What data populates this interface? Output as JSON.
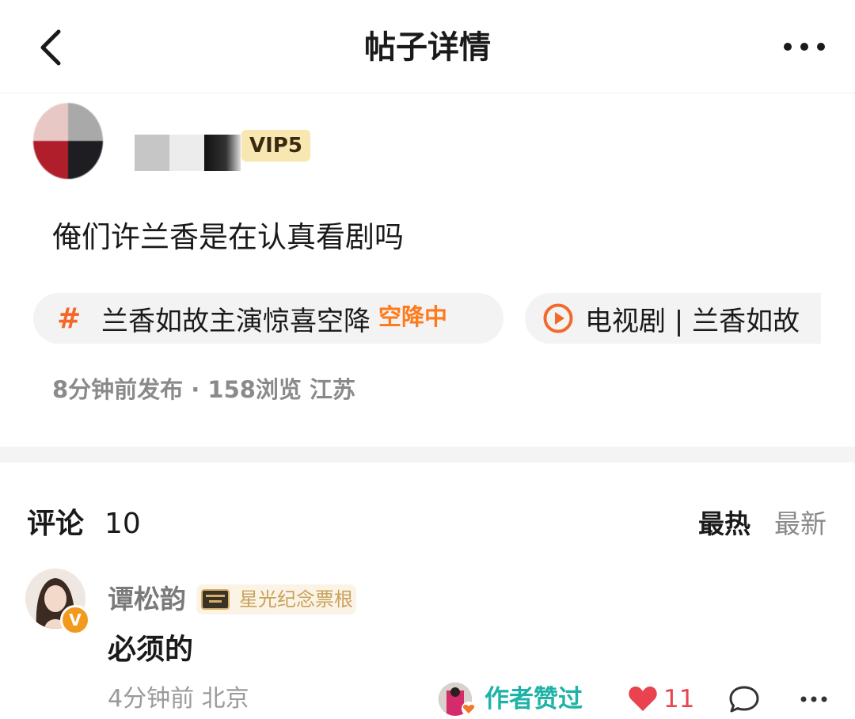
{
  "header": {
    "title": "帖子详情",
    "back_icon": "chevron-left-icon",
    "more_icon": "more-horizontal-icon"
  },
  "author": {
    "vip_badge": "VIP5"
  },
  "post": {
    "text": "俺们许兰香是在认真看剧吗",
    "topic_chip": {
      "icon": "hash-icon",
      "hash_symbol": "#",
      "label": "兰香如故主演惊喜空降",
      "badge": "空降中"
    },
    "video_chip": {
      "icon": "play-circle-icon",
      "label": "电视剧 | 兰香如故"
    },
    "meta": "8分钟前发布 · 158浏览 江苏"
  },
  "comments": {
    "title": "评论",
    "count": "10",
    "sort_hot": "最热",
    "sort_new": "最新",
    "items": [
      {
        "user_name": "谭松韵",
        "verified_badge": "V",
        "ticket_label": "星光纪念票根",
        "text": "必须的",
        "meta": "4分钟前 北京",
        "author_liked": "作者赞过",
        "like_count": "11"
      }
    ]
  },
  "colors": {
    "accent_orange": "#f4692a",
    "vip_bg": "#f8e7b0",
    "author_liked": "#1fb3a8",
    "like_red": "#e8434e"
  }
}
